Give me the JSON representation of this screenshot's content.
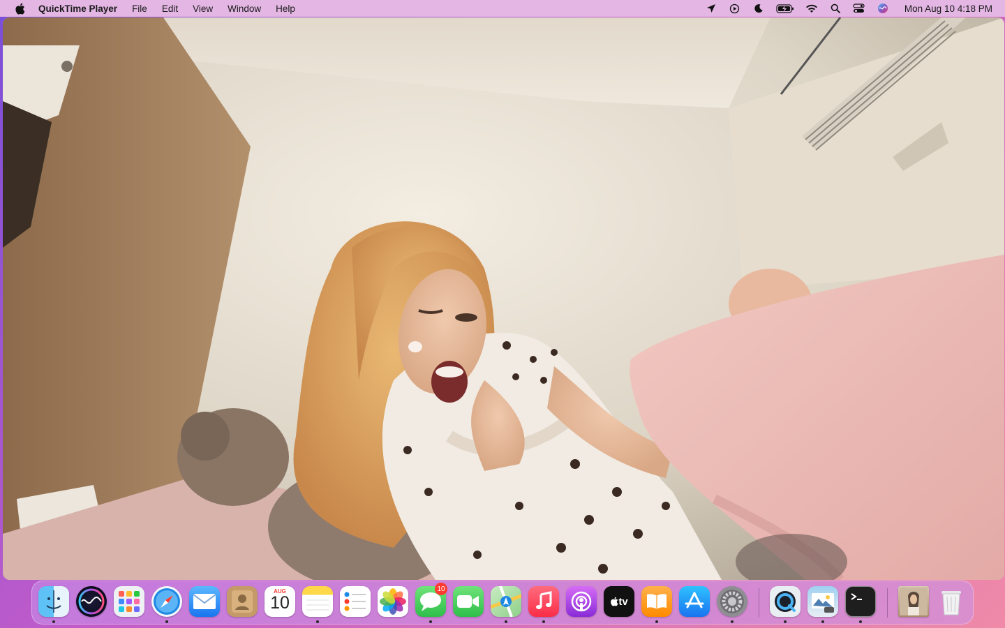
{
  "menubar": {
    "app_name": "QuickTime Player",
    "items": [
      "File",
      "Edit",
      "View",
      "Window",
      "Help"
    ],
    "clock": "Mon Aug 10  4:18 PM"
  },
  "status_icons": [
    "location-icon",
    "screen-recording-icon",
    "do-not-disturb-moon-icon",
    "battery-charging-icon",
    "wifi-icon",
    "spotlight-search-icon",
    "control-center-icon",
    "siri-icon"
  ],
  "dock": {
    "apps": [
      {
        "name": "Finder",
        "icon": "finder-icon",
        "running": true
      },
      {
        "name": "Siri",
        "icon": "siri-icon",
        "running": false
      },
      {
        "name": "Launchpad",
        "icon": "launchpad-icon",
        "running": false
      },
      {
        "name": "Safari",
        "icon": "safari-icon",
        "running": true
      },
      {
        "name": "Mail",
        "icon": "mail-icon",
        "running": false
      },
      {
        "name": "Contacts",
        "icon": "contacts-icon",
        "running": false
      },
      {
        "name": "Calendar",
        "icon": "calendar-icon",
        "running": false
      },
      {
        "name": "Notes",
        "icon": "notes-icon",
        "running": true
      },
      {
        "name": "Reminders",
        "icon": "reminders-icon",
        "running": false
      },
      {
        "name": "Photos",
        "icon": "photos-icon",
        "running": false
      },
      {
        "name": "Messages",
        "icon": "messages-icon",
        "running": true
      },
      {
        "name": "FaceTime",
        "icon": "facetime-icon",
        "running": false
      },
      {
        "name": "Maps",
        "icon": "maps-icon",
        "running": true
      },
      {
        "name": "Music",
        "icon": "music-icon",
        "running": true
      },
      {
        "name": "Podcasts",
        "icon": "podcasts-icon",
        "running": false
      },
      {
        "name": "TV",
        "icon": "apple-tv-icon",
        "running": false
      },
      {
        "name": "Books",
        "icon": "books-icon",
        "running": true
      },
      {
        "name": "App Store",
        "icon": "app-store-icon",
        "running": false
      },
      {
        "name": "System Preferences",
        "icon": "system-preferences-icon",
        "running": true
      },
      {
        "name": "QuickTime Player",
        "icon": "quicktime-icon",
        "running": true
      },
      {
        "name": "Preview",
        "icon": "preview-icon",
        "running": true
      },
      {
        "name": "Terminal",
        "icon": "terminal-icon",
        "running": true
      },
      {
        "name": "Recent Photo",
        "icon": "photo-thumbnail-icon",
        "running": false
      },
      {
        "name": "Trash",
        "icon": "trash-icon",
        "running": false
      }
    ],
    "calendar": {
      "month": "AUG",
      "day": "10"
    },
    "messages_badge": "10",
    "tv_label": "tv"
  },
  "colors": {
    "menubar": "#e3b6e3",
    "dock": "#c896eb",
    "badge": "#ff3b30"
  }
}
